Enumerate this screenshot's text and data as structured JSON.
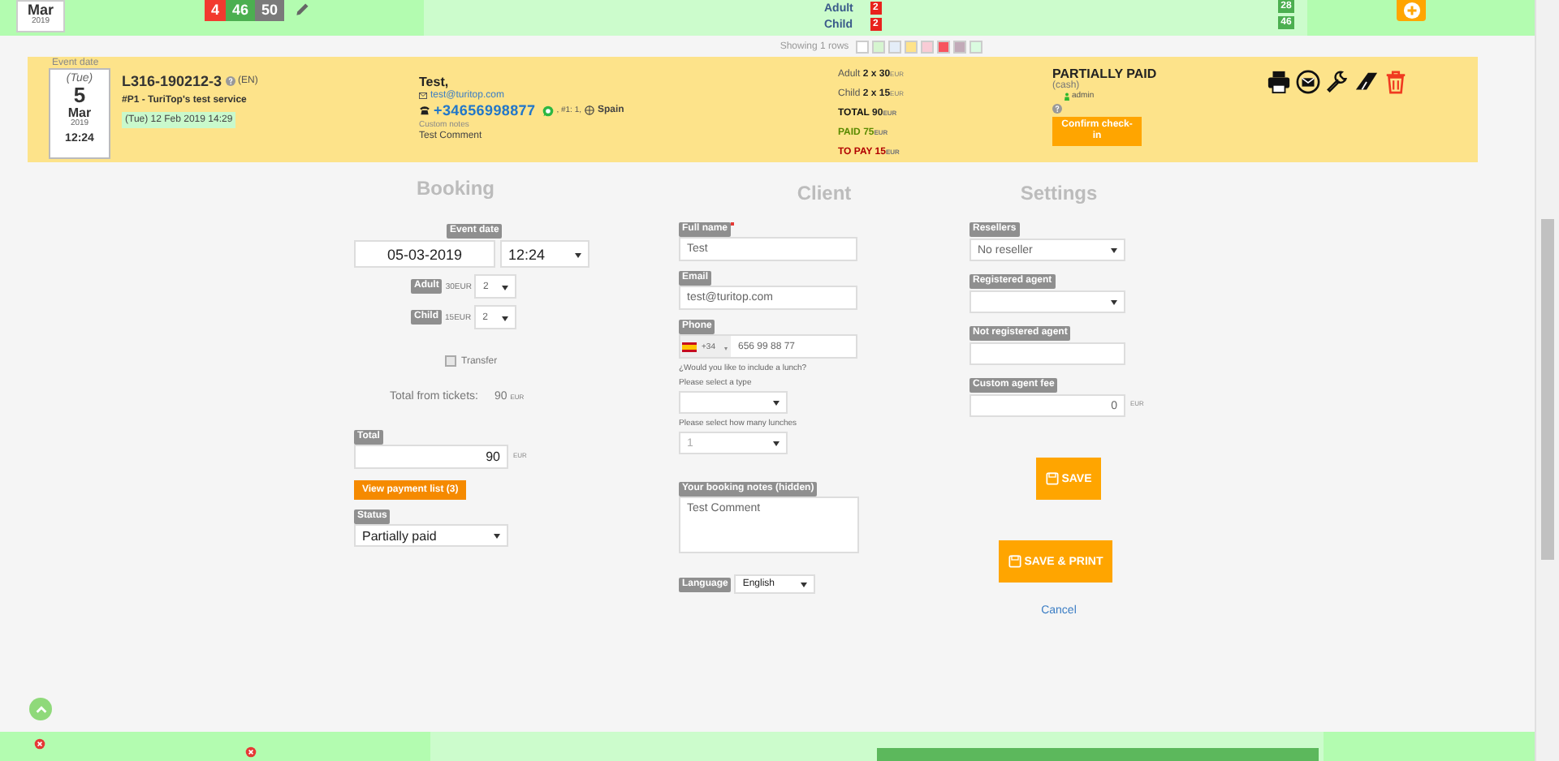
{
  "top_row": {
    "month": "Mar",
    "year": "2019",
    "counts": [
      {
        "value": "4",
        "color": "#f23a2f"
      },
      {
        "value": "46",
        "color": "#4caf50"
      },
      {
        "value": "50",
        "color": "#7a7a7a"
      }
    ],
    "tickets": [
      {
        "label": "Adult",
        "count": "2"
      },
      {
        "label": "Child",
        "count": "2"
      }
    ],
    "availability": [
      "28",
      "46"
    ]
  },
  "legend": {
    "text": "Showing 1 rows",
    "swatches": [
      {
        "color": "#ffffff"
      },
      {
        "color": "#d6f5d0"
      },
      {
        "color": "#e4edf8"
      },
      {
        "color": "#ffe38a"
      },
      {
        "color": "#f9ccd6"
      },
      {
        "color": "#f7545f"
      },
      {
        "color": "#c2aab8"
      },
      {
        "color": "#dafbe0"
      }
    ]
  },
  "booking_card": {
    "event_date_label": "Event date",
    "day_name": "(Tue)",
    "day": "5",
    "month": "Mar",
    "year": "2019",
    "time": "12:24",
    "code": "L316-190212-3",
    "language": "(EN)",
    "service": "#P1 - TuriTop's test service",
    "created": "(Tue) 12 Feb 2019 14:29",
    "client_name": "Test,",
    "email": "test@turitop.com",
    "phone": "+34656998877",
    "extra": ", #1: 1,",
    "country": "Spain",
    "notes_label": "Custom notes",
    "notes": "Test Comment",
    "price_lines": [
      {
        "label": "Adult",
        "value": "2 x 30",
        "unit": "EUR",
        "kind": "plain"
      },
      {
        "label": "Child",
        "value": "2 x 15",
        "unit": "EUR",
        "kind": "plain"
      },
      {
        "label": "TOTAL",
        "value": "90",
        "unit": "EUR",
        "kind": "total"
      },
      {
        "label": "PAID",
        "value": "75",
        "unit": "EUR",
        "kind": "paid"
      },
      {
        "label": "TO PAY",
        "value": "15",
        "unit": "EUR",
        "kind": "due"
      }
    ],
    "status": "PARTIALLY PAID",
    "method": "(cash)",
    "user": "admin",
    "confirm_button": "Confirm check-in"
  },
  "booking": {
    "title": "Booking",
    "event_date_label": "Event date",
    "date": "05-03-2019",
    "time": "12:24",
    "tickets": [
      {
        "label": "Adult",
        "price": "30",
        "unit": "EUR",
        "quantity": "2"
      },
      {
        "label": "Child",
        "price": "15",
        "unit": "EUR",
        "quantity": "2"
      }
    ],
    "transfer": {
      "label": "Transfer",
      "checked": false
    },
    "tickets_total_label": "Total from tickets:",
    "tickets_total": "90",
    "tickets_total_unit": "EUR",
    "total_label": "Total",
    "total": "90",
    "total_unit": "EUR",
    "payment_button": "View payment list (3)",
    "status_label": "Status",
    "status": "Partially paid"
  },
  "client": {
    "title": "Client",
    "full_name_label": "Full name",
    "full_name_required": true,
    "full_name": "Test",
    "email_label": "Email",
    "email": "test@turitop.com",
    "phone_label": "Phone",
    "dial_code": "+34",
    "phone": "656 99 88 77",
    "lunch_question": "¿Would you like to include a lunch?",
    "type_label": "Please select a type",
    "count_label": "Please select how many lunches",
    "count": "1",
    "notes_label": "Your booking notes (hidden)",
    "notes": "Test Comment",
    "language_label": "Language",
    "language": "English"
  },
  "settings": {
    "title": "Settings",
    "resellers_label": "Resellers",
    "reseller": "No reseller",
    "registered_agent_label": "Registered agent",
    "not_registered_agent_label": "Not registered agent",
    "fee_label": "Custom agent fee",
    "fee": "0",
    "fee_unit": "EUR",
    "save_button": "SAVE",
    "save_print_button": "SAVE & PRINT",
    "cancel_link": "Cancel"
  },
  "bottom_row": {
    "progress": {
      "level": 1
    }
  }
}
